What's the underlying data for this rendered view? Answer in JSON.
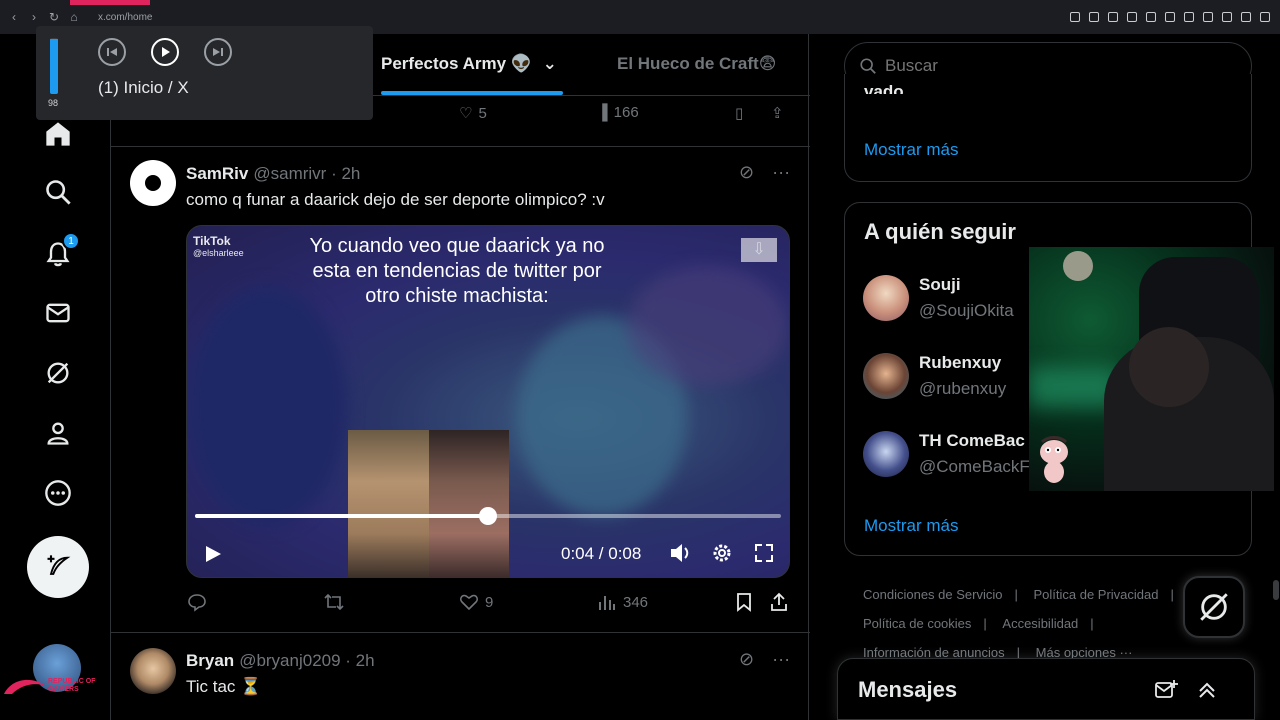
{
  "browser": {
    "url": "x.com/home"
  },
  "media_popup": {
    "volume_value": 98,
    "volume_level": 0.98,
    "title": "(1) Inicio / X"
  },
  "left_nav": {
    "notifications_badge": "1",
    "footer_brand": "REPUBLIC OF GAMERS"
  },
  "tabs": [
    {
      "label": "Perfectos Army 👽",
      "active": true
    },
    {
      "label": "El Hueco de Craft😨",
      "active": false
    }
  ],
  "prev_tweet_actions": {
    "likes": "5",
    "views": "166"
  },
  "tweet1": {
    "name": "SamRiv",
    "handle": "@samrivr · 2h",
    "text": "como q funar a daarick dejo de ser deporte olimpico? :v",
    "video": {
      "caption": "Yo cuando veo que daarick ya no esta en tendencias de twitter por otro chiste machista:",
      "watermark_brand": "TikTok",
      "watermark_user": "@elsharleee",
      "time": "0:04 / 0:08",
      "progress": 0.5
    },
    "actions": {
      "likes": "9",
      "views": "346"
    }
  },
  "tweet2": {
    "name": "Bryan",
    "handle": "@bryanj0209 · 2h",
    "text": "Tic tac ⏳"
  },
  "search": {
    "placeholder": "Buscar"
  },
  "trends_card": {
    "truncated_text": "vado",
    "show_more": "Mostrar más"
  },
  "who_to_follow": {
    "title": "A quién seguir",
    "items": [
      {
        "name": "Souji",
        "handle": "@SoujiOkita"
      },
      {
        "name": "Rubenxuy",
        "handle": "@rubenxuy"
      },
      {
        "name": "TH ComeBac",
        "handle": "@ComeBackFr"
      }
    ],
    "show_more": "Mostrar más"
  },
  "footer_links": [
    "Condiciones de Servicio",
    "Política de Privacidad",
    "Política de cookies",
    "Accesibilidad",
    "Información de anuncios",
    "Más opciones ···"
  ],
  "messages": {
    "title": "Mensajes"
  },
  "colors": {
    "accent": "#1d9bf0",
    "background": "#000000",
    "muted": "#71767b",
    "text": "#e7e9ea"
  }
}
